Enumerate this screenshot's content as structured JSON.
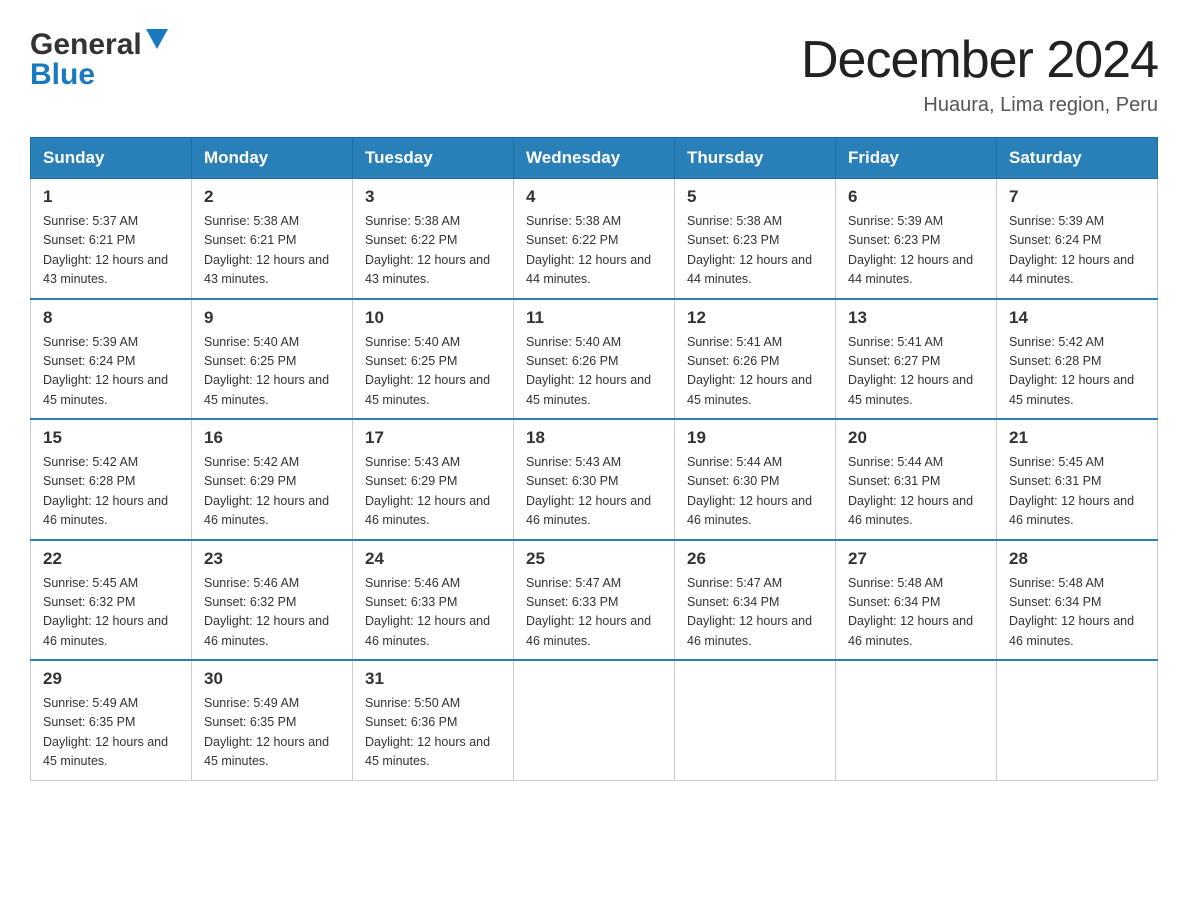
{
  "logo": {
    "general": "General",
    "blue": "Blue",
    "tagline": "GeneralBlue"
  },
  "title": "December 2024",
  "subtitle": "Huaura, Lima region, Peru",
  "headers": [
    "Sunday",
    "Monday",
    "Tuesday",
    "Wednesday",
    "Thursday",
    "Friday",
    "Saturday"
  ],
  "weeks": [
    [
      {
        "day": "1",
        "sunrise": "5:37 AM",
        "sunset": "6:21 PM",
        "daylight": "12 hours and 43 minutes."
      },
      {
        "day": "2",
        "sunrise": "5:38 AM",
        "sunset": "6:21 PM",
        "daylight": "12 hours and 43 minutes."
      },
      {
        "day": "3",
        "sunrise": "5:38 AM",
        "sunset": "6:22 PM",
        "daylight": "12 hours and 43 minutes."
      },
      {
        "day": "4",
        "sunrise": "5:38 AM",
        "sunset": "6:22 PM",
        "daylight": "12 hours and 44 minutes."
      },
      {
        "day": "5",
        "sunrise": "5:38 AM",
        "sunset": "6:23 PM",
        "daylight": "12 hours and 44 minutes."
      },
      {
        "day": "6",
        "sunrise": "5:39 AM",
        "sunset": "6:23 PM",
        "daylight": "12 hours and 44 minutes."
      },
      {
        "day": "7",
        "sunrise": "5:39 AM",
        "sunset": "6:24 PM",
        "daylight": "12 hours and 44 minutes."
      }
    ],
    [
      {
        "day": "8",
        "sunrise": "5:39 AM",
        "sunset": "6:24 PM",
        "daylight": "12 hours and 45 minutes."
      },
      {
        "day": "9",
        "sunrise": "5:40 AM",
        "sunset": "6:25 PM",
        "daylight": "12 hours and 45 minutes."
      },
      {
        "day": "10",
        "sunrise": "5:40 AM",
        "sunset": "6:25 PM",
        "daylight": "12 hours and 45 minutes."
      },
      {
        "day": "11",
        "sunrise": "5:40 AM",
        "sunset": "6:26 PM",
        "daylight": "12 hours and 45 minutes."
      },
      {
        "day": "12",
        "sunrise": "5:41 AM",
        "sunset": "6:26 PM",
        "daylight": "12 hours and 45 minutes."
      },
      {
        "day": "13",
        "sunrise": "5:41 AM",
        "sunset": "6:27 PM",
        "daylight": "12 hours and 45 minutes."
      },
      {
        "day": "14",
        "sunrise": "5:42 AM",
        "sunset": "6:28 PM",
        "daylight": "12 hours and 45 minutes."
      }
    ],
    [
      {
        "day": "15",
        "sunrise": "5:42 AM",
        "sunset": "6:28 PM",
        "daylight": "12 hours and 46 minutes."
      },
      {
        "day": "16",
        "sunrise": "5:42 AM",
        "sunset": "6:29 PM",
        "daylight": "12 hours and 46 minutes."
      },
      {
        "day": "17",
        "sunrise": "5:43 AM",
        "sunset": "6:29 PM",
        "daylight": "12 hours and 46 minutes."
      },
      {
        "day": "18",
        "sunrise": "5:43 AM",
        "sunset": "6:30 PM",
        "daylight": "12 hours and 46 minutes."
      },
      {
        "day": "19",
        "sunrise": "5:44 AM",
        "sunset": "6:30 PM",
        "daylight": "12 hours and 46 minutes."
      },
      {
        "day": "20",
        "sunrise": "5:44 AM",
        "sunset": "6:31 PM",
        "daylight": "12 hours and 46 minutes."
      },
      {
        "day": "21",
        "sunrise": "5:45 AM",
        "sunset": "6:31 PM",
        "daylight": "12 hours and 46 minutes."
      }
    ],
    [
      {
        "day": "22",
        "sunrise": "5:45 AM",
        "sunset": "6:32 PM",
        "daylight": "12 hours and 46 minutes."
      },
      {
        "day": "23",
        "sunrise": "5:46 AM",
        "sunset": "6:32 PM",
        "daylight": "12 hours and 46 minutes."
      },
      {
        "day": "24",
        "sunrise": "5:46 AM",
        "sunset": "6:33 PM",
        "daylight": "12 hours and 46 minutes."
      },
      {
        "day": "25",
        "sunrise": "5:47 AM",
        "sunset": "6:33 PM",
        "daylight": "12 hours and 46 minutes."
      },
      {
        "day": "26",
        "sunrise": "5:47 AM",
        "sunset": "6:34 PM",
        "daylight": "12 hours and 46 minutes."
      },
      {
        "day": "27",
        "sunrise": "5:48 AM",
        "sunset": "6:34 PM",
        "daylight": "12 hours and 46 minutes."
      },
      {
        "day": "28",
        "sunrise": "5:48 AM",
        "sunset": "6:34 PM",
        "daylight": "12 hours and 46 minutes."
      }
    ],
    [
      {
        "day": "29",
        "sunrise": "5:49 AM",
        "sunset": "6:35 PM",
        "daylight": "12 hours and 45 minutes."
      },
      {
        "day": "30",
        "sunrise": "5:49 AM",
        "sunset": "6:35 PM",
        "daylight": "12 hours and 45 minutes."
      },
      {
        "day": "31",
        "sunrise": "5:50 AM",
        "sunset": "6:36 PM",
        "daylight": "12 hours and 45 minutes."
      },
      null,
      null,
      null,
      null
    ]
  ]
}
